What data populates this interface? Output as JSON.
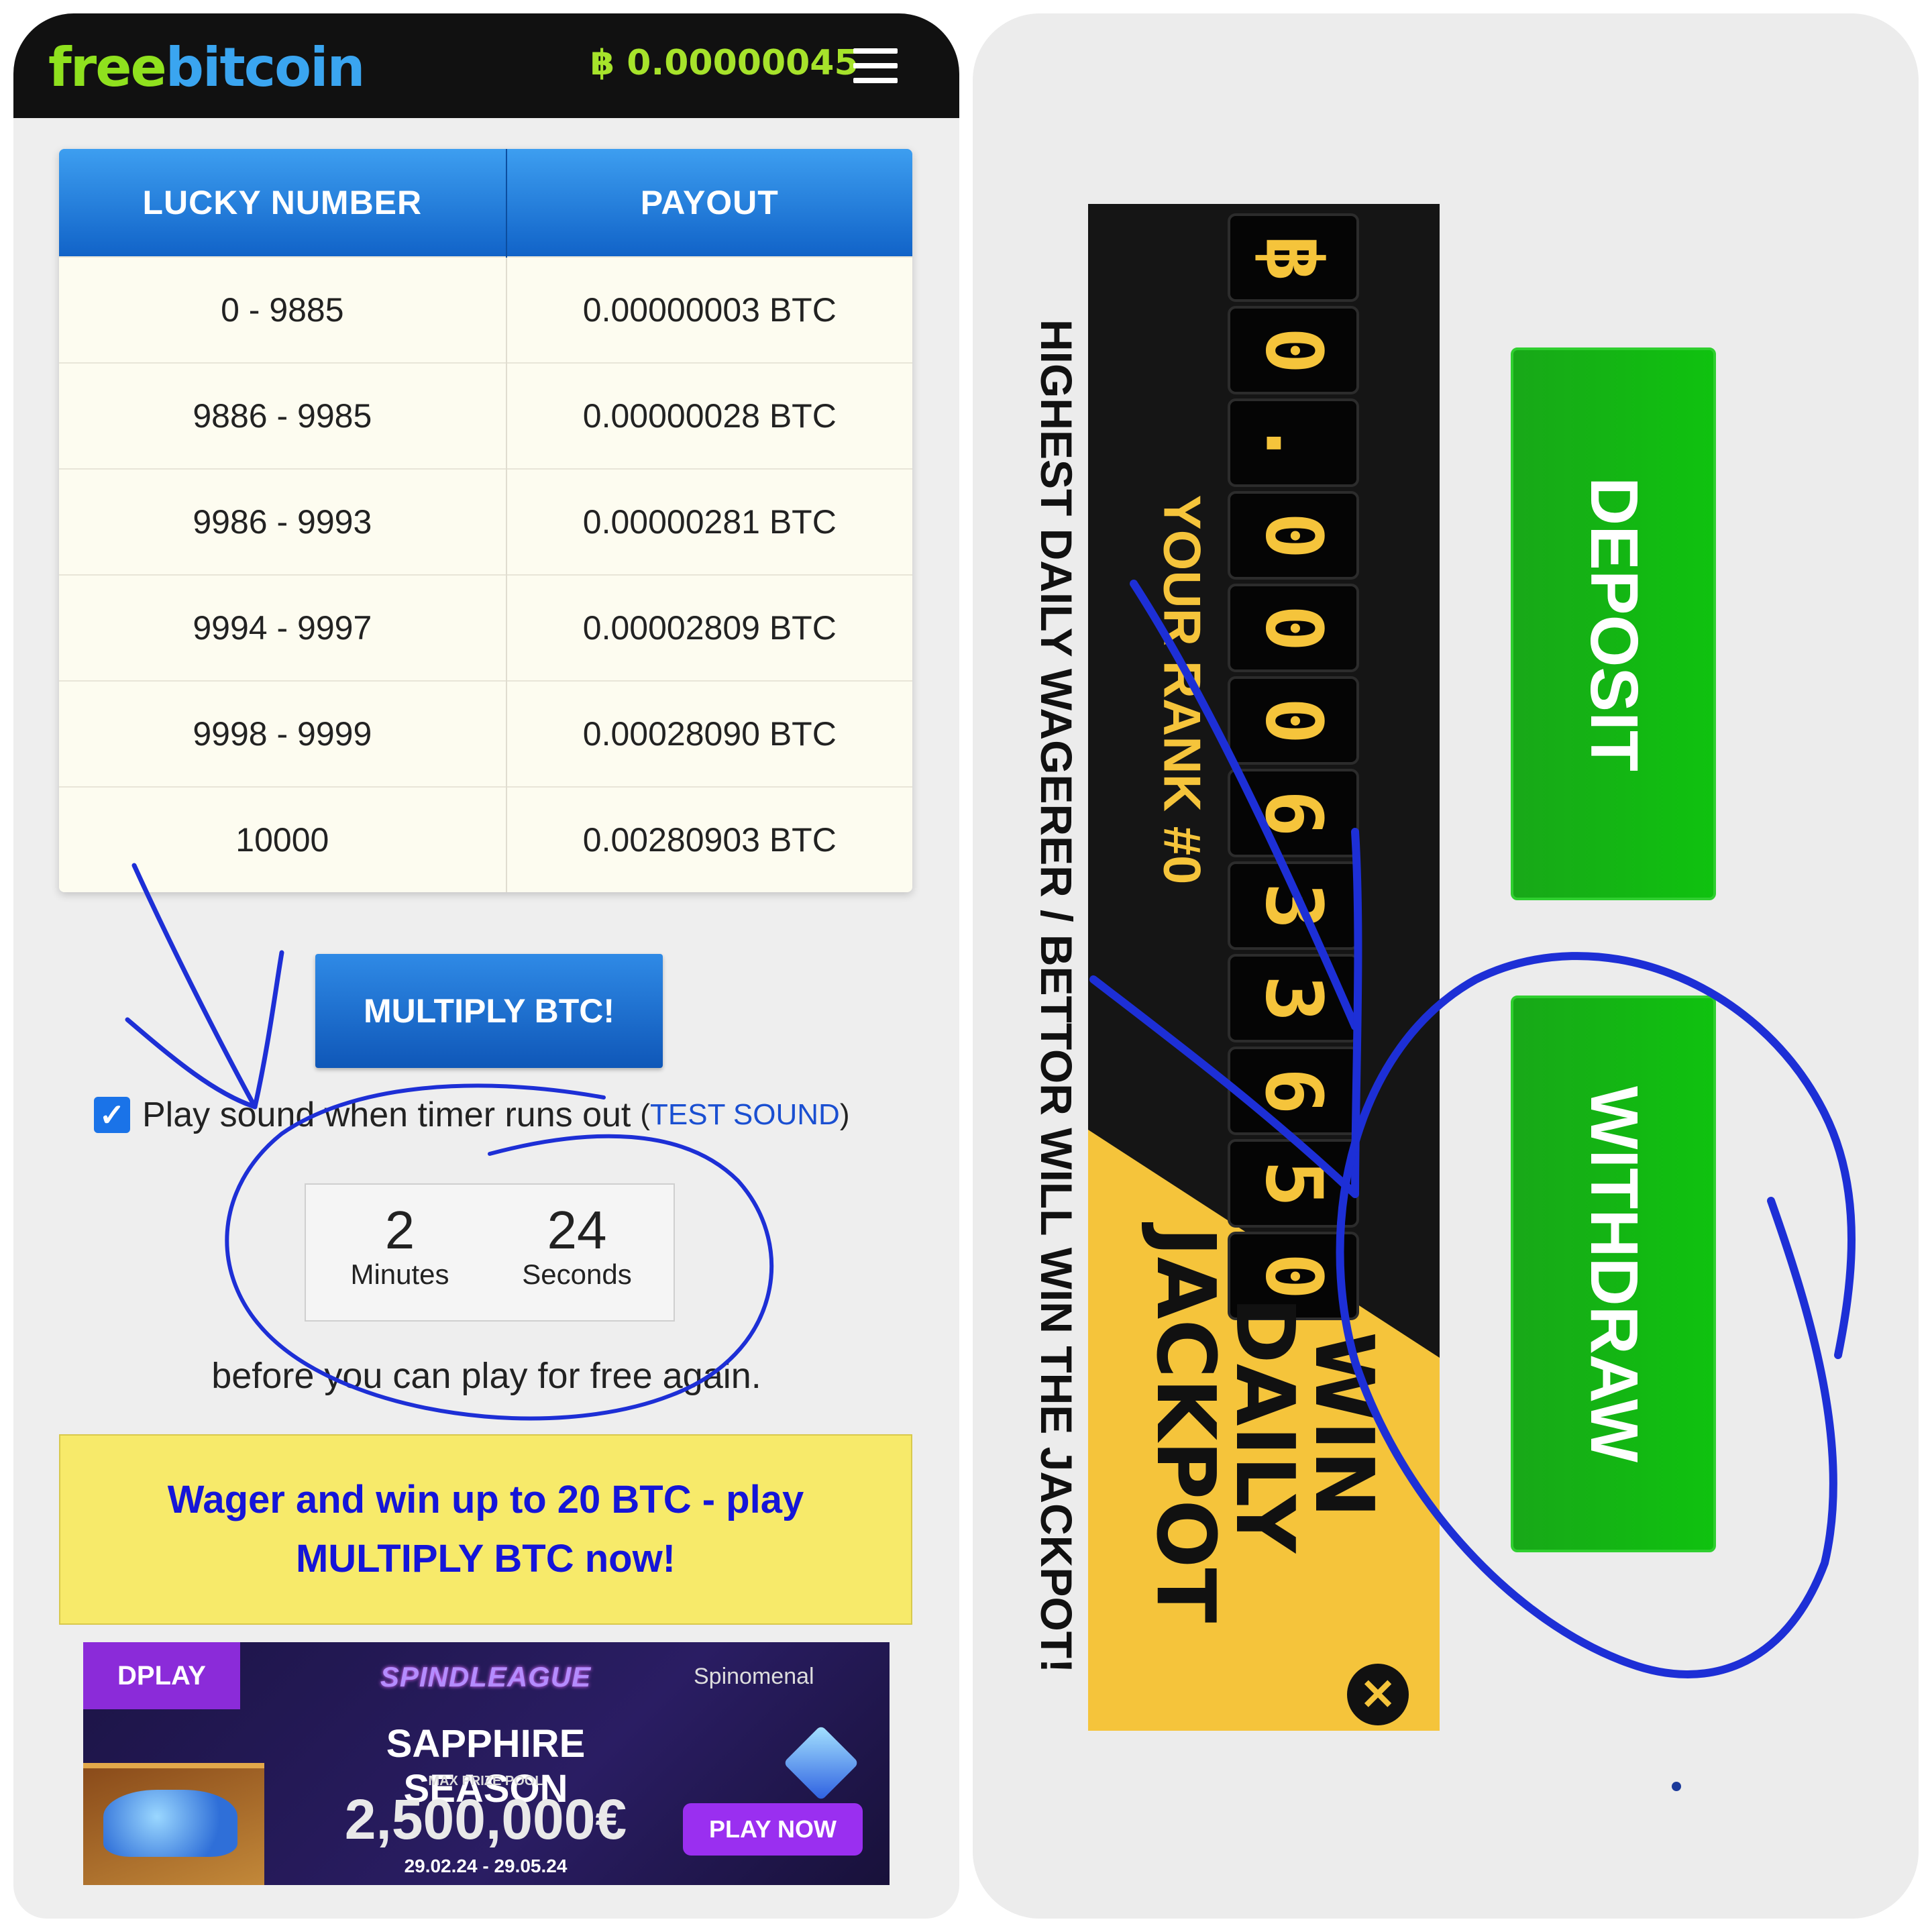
{
  "left": {
    "logo": {
      "part1": "free",
      "part2": "bitcoin"
    },
    "balance": "฿ 0.00000045",
    "menu_icon": "hamburger-menu-icon",
    "table": {
      "headers": [
        "LUCKY NUMBER",
        "PAYOUT"
      ],
      "rows": [
        [
          "0 - 9885",
          "0.00000003 BTC"
        ],
        [
          "9886 - 9985",
          "0.00000028 BTC"
        ],
        [
          "9986 - 9993",
          "0.00000281 BTC"
        ],
        [
          "9994 - 9997",
          "0.00002809 BTC"
        ],
        [
          "9998 - 9999",
          "0.00028090 BTC"
        ],
        [
          "10000",
          "0.00280903 BTC"
        ]
      ]
    },
    "multiply_button": "MULTIPLY BTC!",
    "sound": {
      "checked": true,
      "label": "Play sound when timer runs out",
      "test_open": "(",
      "test_link": "TEST SOUND",
      "test_close": ")"
    },
    "timer": {
      "minutes": "2",
      "minutes_label": "Minutes",
      "seconds": "24",
      "seconds_label": "Seconds"
    },
    "before_text": "before you can play for free again.",
    "wager_banner": "Wager and win up to 20 BTC - play MULTIPLY BTC now!",
    "ad": {
      "brand": "DPLAY",
      "title_logo": "SPINDLEAGUE",
      "provider": "Spinomenal",
      "season": "SAPPHIRE SEASON",
      "pool_label": "MAX PRIZE POOL",
      "amount": "2,500,000€",
      "dates": "29.02.24 - 29.05.24",
      "cta": "PLAY NOW"
    }
  },
  "right": {
    "jackpot_amount_digits": [
      "฿",
      "0",
      ".",
      "0",
      "0",
      "0",
      "6",
      "3",
      "3",
      "6",
      "5",
      "0"
    ],
    "your_rank": "YOUR RANK #0",
    "jackpot_title_lines": [
      "WIN",
      "DAILY",
      "JACKPOT"
    ],
    "highest_wagerer": "HIGHEST DAILY WAGERER / BETTOR WILL WIN THE JACKPOT!",
    "deposit_button": "DEPOSIT",
    "withdraw_button": "WITHDRAW"
  },
  "colors": {
    "accent_blue": "#1163c8",
    "logo_green": "#8fe11e",
    "logo_blue": "#3aa5f0",
    "jackpot_yellow": "#f5c43b",
    "button_green": "#18a818",
    "ink_annotation": "#1d2fd6"
  }
}
